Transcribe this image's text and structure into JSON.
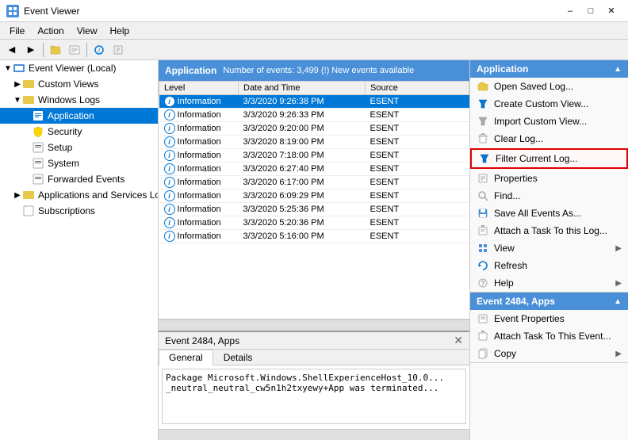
{
  "titlebar": {
    "title": "Event Viewer",
    "controls": [
      "minimize",
      "maximize",
      "close"
    ]
  },
  "menubar": {
    "items": [
      "File",
      "Action",
      "View",
      "Help"
    ]
  },
  "log_header": {
    "title": "Application",
    "count": "Number of events: 3,499 (!) New events available"
  },
  "table": {
    "columns": [
      "Level",
      "Date and Time",
      "Source"
    ],
    "rows": [
      {
        "level": "Information",
        "date": "3/3/2020 9:26:38 PM",
        "source": "ESENT"
      },
      {
        "level": "Information",
        "date": "3/3/2020 9:26:33 PM",
        "source": "ESENT"
      },
      {
        "level": "Information",
        "date": "3/3/2020 9:20:00 PM",
        "source": "ESENT"
      },
      {
        "level": "Information",
        "date": "3/3/2020 8:19:00 PM",
        "source": "ESENT"
      },
      {
        "level": "Information",
        "date": "3/3/2020 7:18:00 PM",
        "source": "ESENT"
      },
      {
        "level": "Information",
        "date": "3/3/2020 6:27:40 PM",
        "source": "ESENT"
      },
      {
        "level": "Information",
        "date": "3/3/2020 6:17:00 PM",
        "source": "ESENT"
      },
      {
        "level": "Information",
        "date": "3/3/2020 6:09:29 PM",
        "source": "ESENT"
      },
      {
        "level": "Information",
        "date": "3/3/2020 5:25:36 PM",
        "source": "ESENT"
      },
      {
        "level": "Information",
        "date": "3/3/2020 5:20:36 PM",
        "source": "ESENT"
      },
      {
        "level": "Information",
        "date": "3/3/2020 5:16:00 PM",
        "source": "ESENT"
      }
    ]
  },
  "detail": {
    "title": "Event 2484, Apps",
    "tabs": [
      "General",
      "Details"
    ],
    "active_tab": "General",
    "content": "Package Microsoft.Windows.ShellExperienceHost_10.0...\n_neutral_neutral_cw5n1h2txyewy+App was terminated..."
  },
  "tree": {
    "root": "Event Viewer (Local)",
    "items": [
      {
        "label": "Custom Views",
        "level": 1,
        "expandable": true,
        "expanded": false
      },
      {
        "label": "Windows Logs",
        "level": 1,
        "expandable": true,
        "expanded": true
      },
      {
        "label": "Application",
        "level": 2,
        "expandable": false,
        "selected": true
      },
      {
        "label": "Security",
        "level": 2,
        "expandable": false
      },
      {
        "label": "Setup",
        "level": 2,
        "expandable": false
      },
      {
        "label": "System",
        "level": 2,
        "expandable": false
      },
      {
        "label": "Forwarded Events",
        "level": 2,
        "expandable": false
      },
      {
        "label": "Applications and Services Lo...",
        "level": 1,
        "expandable": true,
        "expanded": false
      },
      {
        "label": "Subscriptions",
        "level": 1,
        "expandable": false
      }
    ]
  },
  "actions": {
    "section1": {
      "title": "Application",
      "items": [
        {
          "label": "Open Saved Log...",
          "icon": "folder-open"
        },
        {
          "label": "Create Custom View...",
          "icon": "filter"
        },
        {
          "label": "Import Custom View...",
          "icon": "import"
        },
        {
          "label": "Clear Log...",
          "icon": "clear"
        },
        {
          "label": "Filter Current Log...",
          "icon": "filter",
          "highlighted": true
        },
        {
          "label": "Properties",
          "icon": "properties"
        },
        {
          "label": "Find...",
          "icon": "find"
        },
        {
          "label": "Save All Events As...",
          "icon": "save"
        },
        {
          "label": "Attach a Task To this Log...",
          "icon": "task"
        },
        {
          "label": "View",
          "icon": "view",
          "hasArrow": true
        },
        {
          "label": "Refresh",
          "icon": "refresh"
        },
        {
          "label": "Help",
          "icon": "help",
          "hasArrow": true
        }
      ]
    },
    "section2": {
      "title": "Event 2484, Apps",
      "items": [
        {
          "label": "Event Properties",
          "icon": "properties"
        },
        {
          "label": "Attach Task To This Event...",
          "icon": "task"
        },
        {
          "label": "Copy",
          "icon": "copy",
          "hasArrow": true
        }
      ]
    }
  }
}
